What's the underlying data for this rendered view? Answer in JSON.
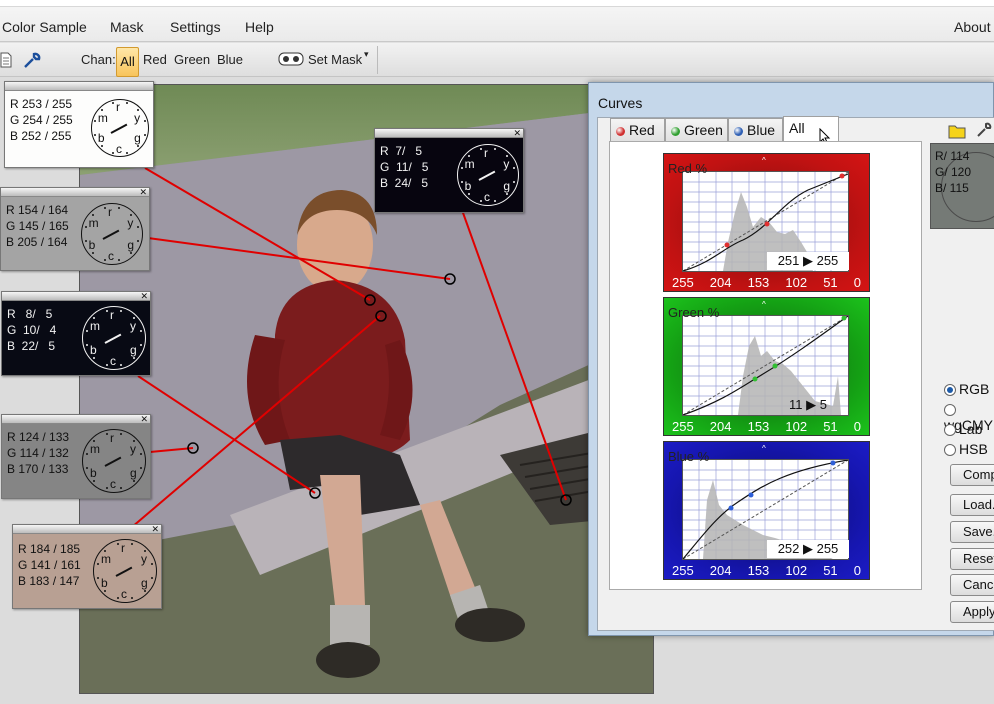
{
  "menubar": {
    "items": [
      "Color Sample",
      "Mask",
      "Settings",
      "Help"
    ],
    "about": "About"
  },
  "toolbar": {
    "chan_label": "Chan:",
    "channels": [
      "All",
      "Red",
      "Green",
      "Blue"
    ],
    "set_mask": "Set Mask"
  },
  "samplers": [
    {
      "r": "R 253 / 255",
      "g": "G 254 / 255",
      "b": "B 252 / 255",
      "bg": "#fdfdfc"
    },
    {
      "r": "R  7/   5",
      "g": "G  11/   5",
      "b": "B  24/   5",
      "bg": "#07050f"
    },
    {
      "r": "R 154 / 164",
      "g": "G 145 / 165",
      "b": "B 205 / 164",
      "bg": "#a4a4a4"
    },
    {
      "r": "R   8/   5",
      "g": "G  10/   4",
      "b": "B  22/   5",
      "bg": "#080a14"
    },
    {
      "r": "R 124 / 133",
      "g": "G 114 / 132",
      "b": "B 170 / 133",
      "bg": "#858585"
    },
    {
      "r": "R 184 / 185",
      "g": "G 141 / 161",
      "b": "B 183 / 147",
      "bg": "#b8a093"
    }
  ],
  "dial_letters": {
    "r": "r",
    "y": "y",
    "g": "g",
    "c": "c",
    "b": "b",
    "m": "m"
  },
  "curves": {
    "title": "Curves",
    "tabs": [
      {
        "label": "Red",
        "bulb": "#d03030"
      },
      {
        "label": "Green",
        "bulb": "#30a030"
      },
      {
        "label": "Blue",
        "bulb": "#2e5fb4"
      },
      {
        "label": "All",
        "bulb": ""
      }
    ],
    "graphs": [
      {
        "label": "Red %",
        "readout": "251 ▶ 255",
        "color": "#b40d0d"
      },
      {
        "label": "Green %",
        "readout": "11 ▶ 5",
        "color": "#12a012"
      },
      {
        "label": "Blue %",
        "readout": "252 ▶ 255",
        "color": "#1313a8"
      }
    ],
    "ticks": [
      "255",
      "204",
      "153",
      "102",
      "51",
      "0"
    ],
    "tick_marker": "^",
    "current": {
      "r": "R/ 114",
      "g": "G/ 120",
      "b": "B/ 115"
    },
    "color_spaces": [
      "RGB",
      "wgCMY",
      "Lab",
      "HSB"
    ],
    "selected_space": "RGB",
    "buttons": [
      "Compare",
      "Load...",
      "Save...",
      "Reset",
      "Cancel",
      "Apply"
    ]
  }
}
